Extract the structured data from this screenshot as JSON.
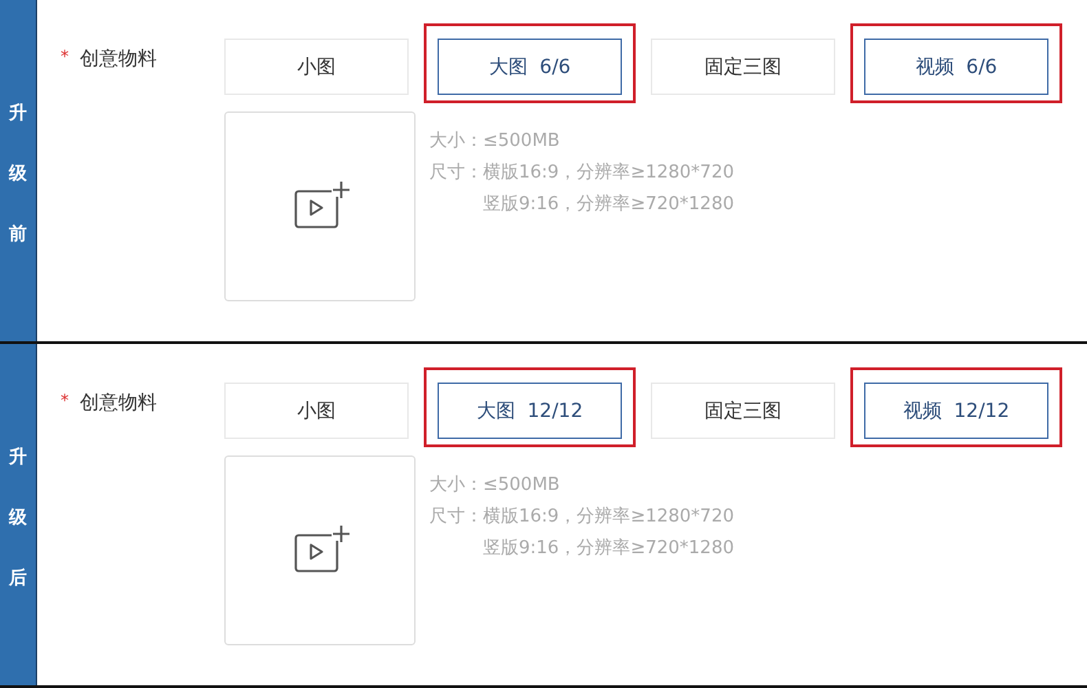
{
  "panels": [
    {
      "side_label": "升级前",
      "field": {
        "required_mark": "*",
        "label": "创意物料",
        "options": [
          {
            "label": "小图",
            "selected": false,
            "highlighted": false
          },
          {
            "label": "大图  6/6",
            "selected": true,
            "highlighted": true
          },
          {
            "label": "固定三图",
            "selected": false,
            "highlighted": false
          },
          {
            "label": "视频  6/6",
            "selected": true,
            "highlighted": true
          }
        ],
        "hints": [
          {
            "label": "大小：",
            "value": "≤500MB"
          },
          {
            "label": "尺寸：",
            "value": "横版16:9，分辨率≥1280*720"
          },
          {
            "value": "竖版9:16，分辨率≥720*1280"
          }
        ]
      }
    },
    {
      "side_label": "升级后",
      "field": {
        "required_mark": "*",
        "label": "创意物料",
        "options": [
          {
            "label": "小图",
            "selected": false,
            "highlighted": false
          },
          {
            "label": "大图  12/12",
            "selected": true,
            "highlighted": true
          },
          {
            "label": "固定三图",
            "selected": false,
            "highlighted": false
          },
          {
            "label": "视频  12/12",
            "selected": true,
            "highlighted": true
          }
        ],
        "hints": [
          {
            "label": "大小：",
            "value": "≤500MB"
          },
          {
            "label": "尺寸：",
            "value": "横版16:9，分辨率≥1280*720"
          },
          {
            "value": "竖版9:16，分辨率≥720*1280"
          }
        ]
      }
    }
  ]
}
